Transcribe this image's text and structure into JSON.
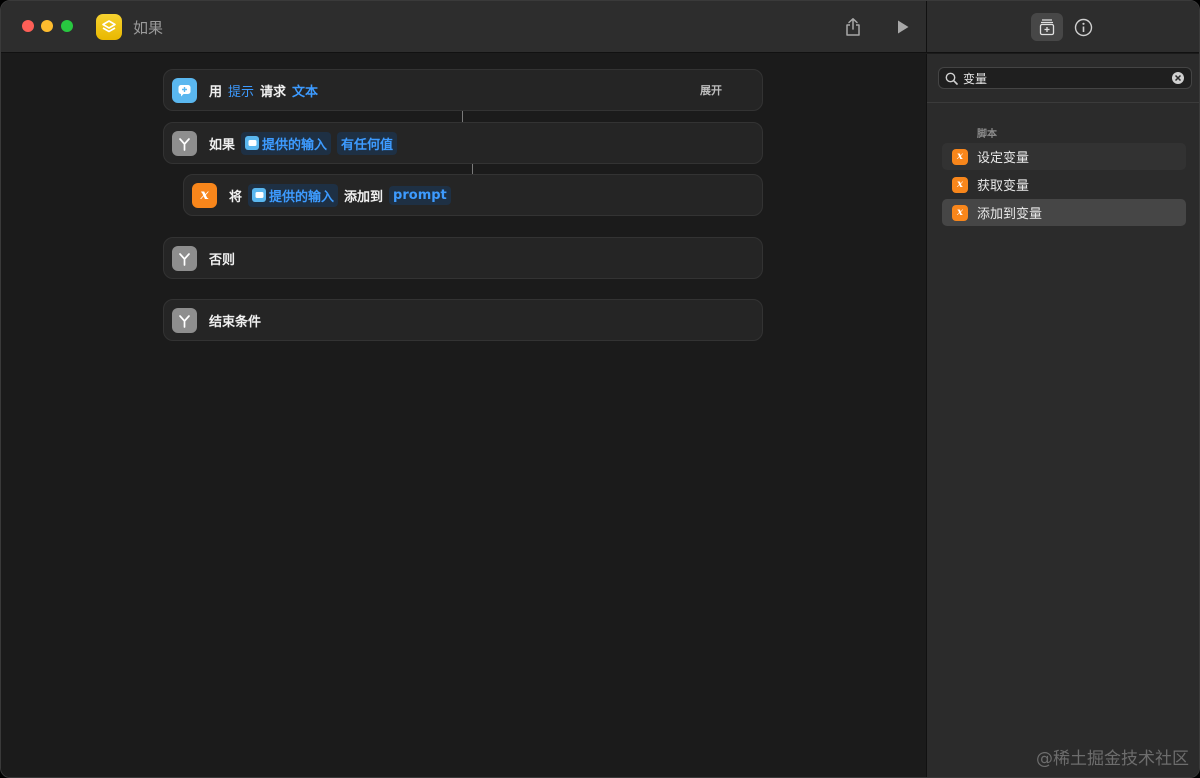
{
  "window": {
    "title": "如果"
  },
  "panel": {
    "search_value": "变量",
    "section_label": "脚本",
    "items": [
      {
        "label": "设定变量"
      },
      {
        "label": "获取变量"
      },
      {
        "label": "添加到变量"
      }
    ]
  },
  "actions": {
    "ask": {
      "kw1": "用",
      "tok1": "提示",
      "kw2": "请求",
      "tok2": "文本",
      "expand": "展开"
    },
    "if": {
      "kw1": "如果",
      "tok1": "提供的输入",
      "tok2": "有任何值"
    },
    "append": {
      "kw1": "将",
      "tok1": "提供的输入",
      "kw2": "添加到",
      "tok2": "prompt"
    },
    "otherwise": {
      "kw1": "否则"
    },
    "endif": {
      "kw1": "结束条件"
    }
  },
  "watermark": "@稀土掘金技术社区",
  "colors": {
    "accent_blue": "#3d9bff",
    "orange": "#f8861b",
    "gray": "#8e8e8e",
    "app_yellow": "#f6d230"
  }
}
